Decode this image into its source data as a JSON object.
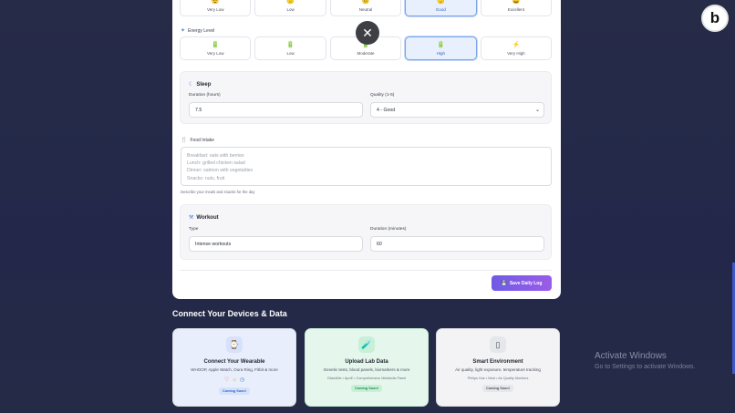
{
  "mood": {
    "options": [
      {
        "label": "Very Low",
        "icon": "😟"
      },
      {
        "label": "Low",
        "icon": "🙁"
      },
      {
        "label": "Neutral",
        "icon": "😐"
      },
      {
        "label": "Good",
        "icon": "🙂",
        "selected": true
      },
      {
        "label": "Excellent",
        "icon": "😄"
      }
    ]
  },
  "energy": {
    "label": "Energy Level",
    "options": [
      {
        "label": "Very Low",
        "icon": "🔋"
      },
      {
        "label": "Low",
        "icon": "🔋"
      },
      {
        "label": "Moderate",
        "icon": "🔋"
      },
      {
        "label": "High",
        "icon": "🔋",
        "selected": true
      },
      {
        "label": "Very High",
        "icon": "⚡"
      }
    ]
  },
  "sleep": {
    "title": "Sleep",
    "duration_label": "Duration (hours)",
    "duration_value": "7.5",
    "quality_label": "Quality (1-5)",
    "quality_value": "4 - Good"
  },
  "food": {
    "label": "Food Intake",
    "placeholder_lines": [
      "Breakfast: oats with berries",
      "Lunch: grilled chicken salad",
      "Dinner: salmon with vegetables",
      "Snacks: nuts, fruit"
    ],
    "hint": "Describe your meals and snacks for the day"
  },
  "workout": {
    "title": "Workout",
    "type_label": "Type",
    "type_value": "Intense workouts",
    "duration_label": "Duration (minutes)",
    "duration_value": "60"
  },
  "save_label": "Save Daily Log",
  "devices": {
    "heading": "Connect Your Devices & Data",
    "cards": [
      {
        "title": "Connect Your Wearable",
        "desc": "WHOOP, Apple Watch, Oura Ring, Fitbit & more",
        "sub": "",
        "badge": "Coming Soon!",
        "bg": "#e8eefc",
        "accent": "#2f62c9"
      },
      {
        "title": "Upload Lab Data",
        "desc": "Genetic tests, blood panels, biomarkers & more",
        "sub": "23andMe • ApoE • Comprehensive Metabolic Panel",
        "badge": "Coming Soon!",
        "bg": "#e5f7ec",
        "accent": "#1f8a4c"
      },
      {
        "title": "Smart Environment",
        "desc": "Air quality, light exposure, temperature tracking",
        "sub": "Philips Hue • Nest • Air Quality Monitors",
        "badge": "Coming Soon!",
        "bg": "#f3f3f5",
        "accent": "#4b5060"
      }
    ]
  },
  "windows": {
    "line1": "Activate Windows",
    "line2": "Go to Settings to activate Windows."
  },
  "logo_letter": "b"
}
